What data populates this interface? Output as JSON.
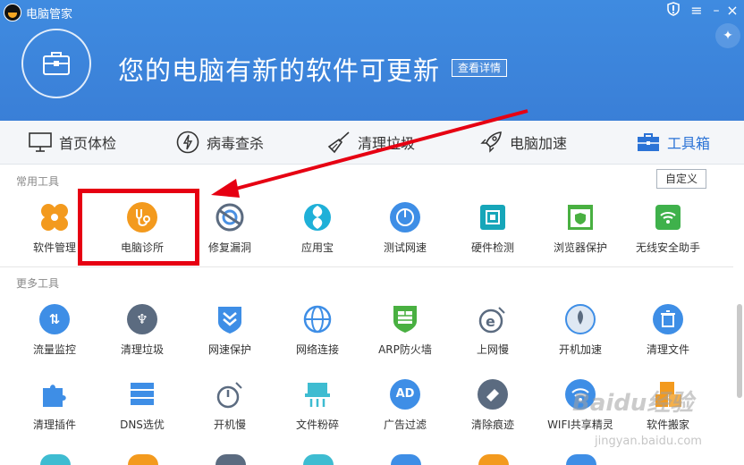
{
  "app": {
    "title": "电脑管家"
  },
  "header": {
    "message": "您的电脑有新的软件可更新",
    "detail_button": "查看详情"
  },
  "nav": {
    "items": [
      {
        "label": "首页体检",
        "icon": "monitor-icon"
      },
      {
        "label": "病毒查杀",
        "icon": "lightning-icon"
      },
      {
        "label": "清理垃圾",
        "icon": "broom-icon"
      },
      {
        "label": "电脑加速",
        "icon": "rocket-icon"
      },
      {
        "label": "工具箱",
        "icon": "toolbox-icon",
        "active": true
      }
    ]
  },
  "common_tools": {
    "title": "常用工具",
    "custom_button": "自定义",
    "items": [
      {
        "label": "软件管理"
      },
      {
        "label": "电脑诊所"
      },
      {
        "label": "修复漏洞"
      },
      {
        "label": "应用宝"
      },
      {
        "label": "测试网速"
      },
      {
        "label": "硬件检测"
      },
      {
        "label": "浏览器保护"
      },
      {
        "label": "无线安全助手"
      }
    ]
  },
  "more_tools": {
    "title": "更多工具",
    "row1": [
      {
        "label": "流量监控"
      },
      {
        "label": "清理垃圾"
      },
      {
        "label": "网速保护"
      },
      {
        "label": "网络连接"
      },
      {
        "label": "ARP防火墙"
      },
      {
        "label": "上网慢"
      },
      {
        "label": "开机加速"
      },
      {
        "label": "清理文件"
      }
    ],
    "row2": [
      {
        "label": "清理插件"
      },
      {
        "label": "DNS选优"
      },
      {
        "label": "开机慢"
      },
      {
        "label": "文件粉碎"
      },
      {
        "label": "广告过滤"
      },
      {
        "label": "清除痕迹"
      },
      {
        "label": "WIFI共享精灵"
      },
      {
        "label": "软件搬家"
      }
    ]
  },
  "colors": {
    "header": "#3a7fd7",
    "accent": "#2b73d6",
    "highlight": "#e60012",
    "arrow": "#e60012"
  },
  "watermark": {
    "brand": "Baidu经验",
    "url": "jingyan.baidu.com"
  }
}
